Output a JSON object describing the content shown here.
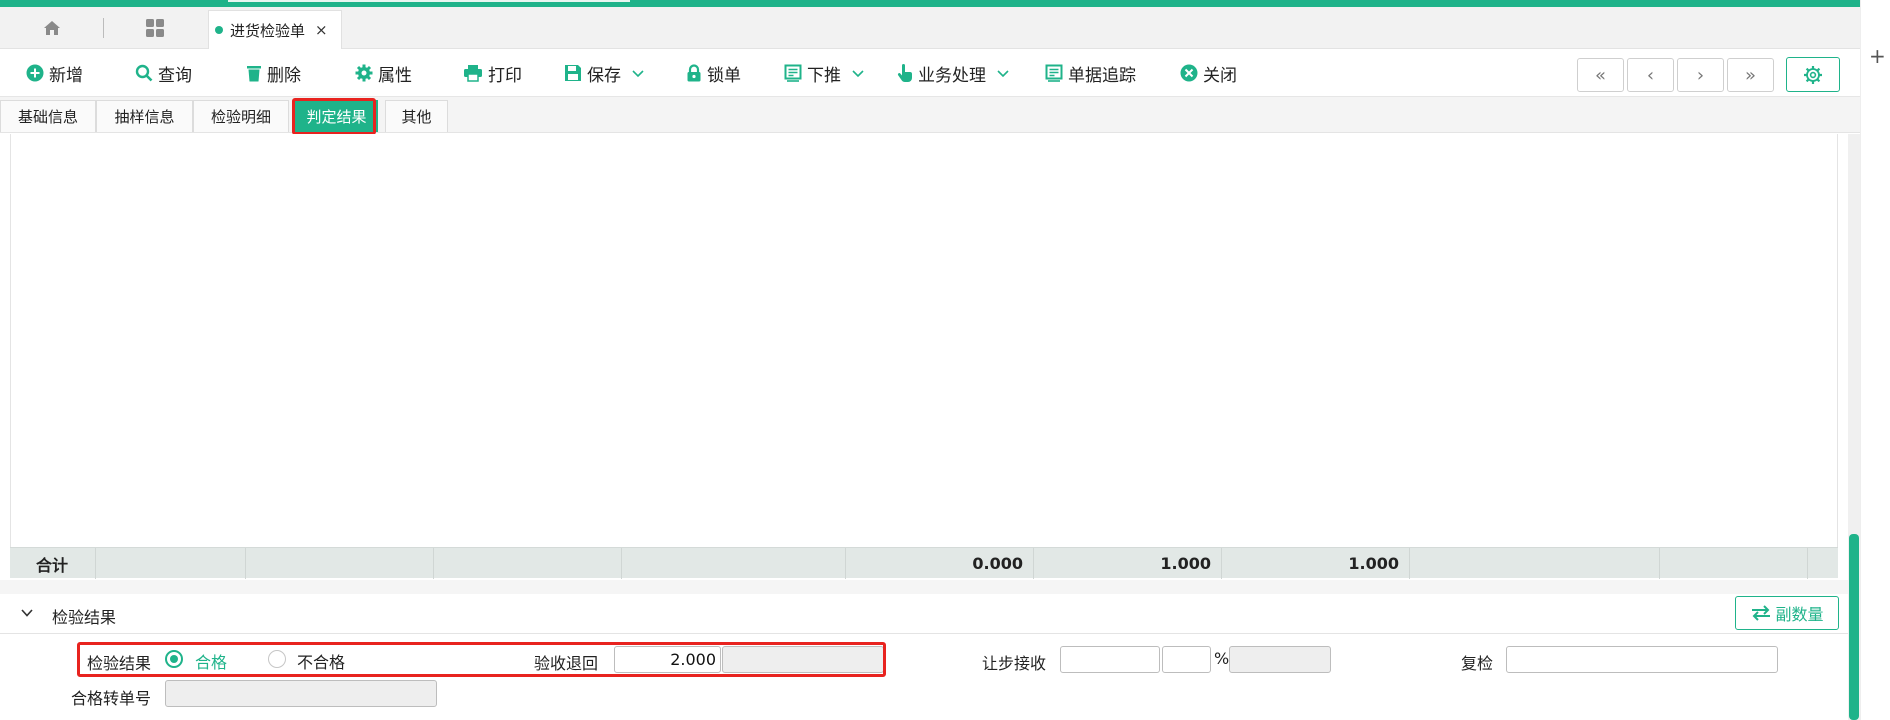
{
  "tabs": {
    "home_icon": "home-icon",
    "apps_icon": "grid-icon",
    "doc_tab_label": "进货检验单",
    "doc_tab_close": "×"
  },
  "toolbar": {
    "new_label": "新增",
    "query_label": "查询",
    "delete_label": "删除",
    "properties_label": "属性",
    "print_label": "打印",
    "save_label": "保存",
    "lock_label": "锁单",
    "push_down_label": "下推",
    "business_label": "业务处理",
    "trace_label": "单据追踪",
    "close_label": "关闭",
    "nav_first": "«",
    "nav_prev": "‹",
    "nav_next": "›",
    "nav_last": "»"
  },
  "subtabs": {
    "items": [
      "基础信息",
      "抽样信息",
      "检验明细",
      "判定结果",
      "其他"
    ],
    "active_index": 3
  },
  "grid": {
    "total_label": "合计",
    "totals": [
      "0.000",
      "1.000",
      "1.000"
    ]
  },
  "section": {
    "title": "检验结果",
    "secondary_qty_button": "副数量"
  },
  "form": {
    "result_label": "检验结果",
    "pass_label": "合格",
    "fail_label": "不合格",
    "selected": "合格",
    "return_label": "验收退回",
    "return_value": "2.000",
    "concession_label": "让步接收",
    "percent_sign": "%",
    "recheck_label": "复检",
    "pass_transfer_label": "合格转单号"
  },
  "colors": {
    "accent": "#1fb38a",
    "highlight": "#e8231f"
  }
}
